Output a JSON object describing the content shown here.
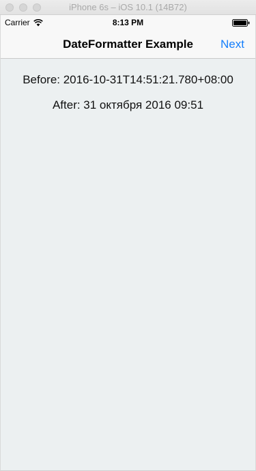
{
  "window": {
    "title": "iPhone 6s – iOS 10.1 (14B72)"
  },
  "status_bar": {
    "carrier": "Carrier",
    "time": "8:13 PM"
  },
  "nav_bar": {
    "title": "DateFormatter Example",
    "next_label": "Next"
  },
  "content": {
    "before": "Before: 2016-10-31T14:51:21.780+08:00",
    "after": "After: 31 октября 2016 09:51"
  },
  "colors": {
    "accent": "#147efb",
    "background": "#ecf0f1",
    "nav_background": "#f8f8f8"
  },
  "icons": {
    "wifi": "wifi-icon",
    "battery": "battery-icon"
  }
}
